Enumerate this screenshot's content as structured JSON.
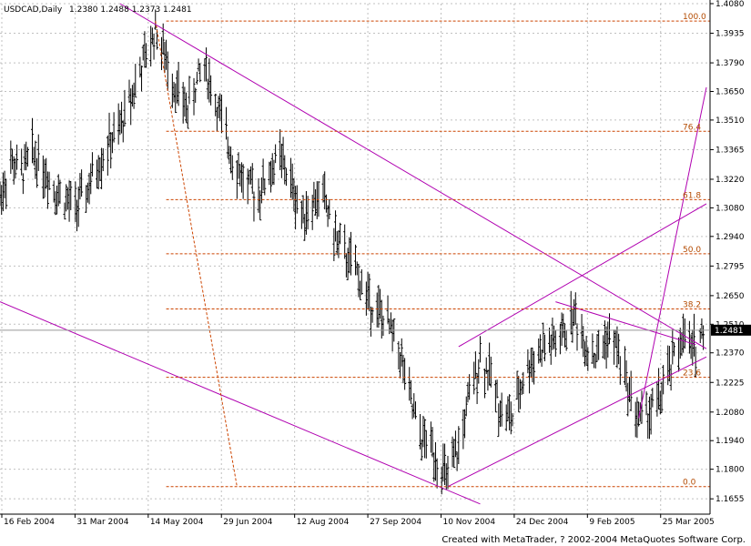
{
  "header": {
    "symbol": "USDCAD,Daily",
    "ohlc": "1.2380 1.2488 1.2373 1.2481"
  },
  "footer": "Created with MetaTrader, ? 2002-2004 MetaQuotes Software Corp.",
  "price_badge": "1.2481",
  "colors": {
    "grid": "#c0c0c0",
    "bars": "#000000",
    "trendline": "#b000b0",
    "fibonacci": "#cc4400"
  },
  "chart_data": {
    "type": "ohlc",
    "title": "USDCAD,Daily",
    "ylim": [
      1.158,
      1.408
    ],
    "y_ticks": [
      1.408,
      1.3935,
      1.379,
      1.365,
      1.351,
      1.3365,
      1.322,
      1.308,
      1.294,
      1.2795,
      1.265,
      1.251,
      1.237,
      1.2225,
      1.208,
      1.194,
      1.18,
      1.1655
    ],
    "x_ticks": [
      "16 Feb 2004",
      "31 Mar 2004",
      "14 May 2004",
      "29 Jun 2004",
      "12 Aug 2004",
      "27 Sep 2004",
      "10 Nov 2004",
      "24 Dec 2004",
      "9 Feb 2005",
      "25 Mar 2005"
    ],
    "x_range": [
      "2004-02-02",
      "2005-05-06"
    ],
    "fibonacci_levels": [
      {
        "label": "100.0",
        "price": 1.3995
      },
      {
        "label": "76.4",
        "price": 1.3455
      },
      {
        "label": "61.8",
        "price": 1.312
      },
      {
        "label": "50.0",
        "price": 1.2855
      },
      {
        "label": "38.2",
        "price": 1.2585
      },
      {
        "label": "23.6",
        "price": 1.225
      },
      {
        "label": "0.0",
        "price": 1.1715
      }
    ],
    "price_path": [
      [
        "2004-02-02",
        1.313
      ],
      [
        "2004-02-09",
        1.33
      ],
      [
        "2004-02-16",
        1.325
      ],
      [
        "2004-02-23",
        1.335
      ],
      [
        "2004-03-01",
        1.328
      ],
      [
        "2004-03-08",
        1.318
      ],
      [
        "2004-03-15",
        1.312
      ],
      [
        "2004-03-22",
        1.308
      ],
      [
        "2004-03-29",
        1.315
      ],
      [
        "2004-04-05",
        1.328
      ],
      [
        "2004-04-12",
        1.338
      ],
      [
        "2004-04-19",
        1.345
      ],
      [
        "2004-04-26",
        1.36
      ],
      [
        "2004-05-03",
        1.375
      ],
      [
        "2004-05-10",
        1.388
      ],
      [
        "2004-05-13",
        1.396
      ],
      [
        "2004-05-20",
        1.38
      ],
      [
        "2004-05-27",
        1.365
      ],
      [
        "2004-06-03",
        1.356
      ],
      [
        "2004-06-10",
        1.372
      ],
      [
        "2004-06-14",
        1.378
      ],
      [
        "2004-06-21",
        1.36
      ],
      [
        "2004-06-28",
        1.342
      ],
      [
        "2004-07-05",
        1.328
      ],
      [
        "2004-07-12",
        1.318
      ],
      [
        "2004-07-19",
        1.315
      ],
      [
        "2004-07-26",
        1.325
      ],
      [
        "2004-08-02",
        1.333
      ],
      [
        "2004-08-09",
        1.32
      ],
      [
        "2004-08-16",
        1.305
      ],
      [
        "2004-08-23",
        1.31
      ],
      [
        "2004-08-30",
        1.315
      ],
      [
        "2004-09-06",
        1.295
      ],
      [
        "2004-09-13",
        1.285
      ],
      [
        "2004-09-20",
        1.278
      ],
      [
        "2004-09-27",
        1.265
      ],
      [
        "2004-10-04",
        1.258
      ],
      [
        "2004-10-11",
        1.25
      ],
      [
        "2004-10-18",
        1.24
      ],
      [
        "2004-10-25",
        1.215
      ],
      [
        "2004-11-01",
        1.195
      ],
      [
        "2004-11-08",
        1.192
      ],
      [
        "2004-11-15",
        1.18
      ],
      [
        "2004-11-19",
        1.175
      ],
      [
        "2004-11-26",
        1.19
      ],
      [
        "2004-12-03",
        1.215
      ],
      [
        "2004-12-10",
        1.235
      ],
      [
        "2004-12-17",
        1.225
      ],
      [
        "2004-12-24",
        1.208
      ],
      [
        "2004-12-31",
        1.205
      ],
      [
        "2005-01-07",
        1.225
      ],
      [
        "2005-01-14",
        1.235
      ],
      [
        "2005-01-21",
        1.24
      ],
      [
        "2005-01-28",
        1.242
      ],
      [
        "2005-02-04",
        1.248
      ],
      [
        "2005-02-09",
        1.256
      ],
      [
        "2005-02-16",
        1.242
      ],
      [
        "2005-02-23",
        1.235
      ],
      [
        "2005-03-02",
        1.245
      ],
      [
        "2005-03-09",
        1.24
      ],
      [
        "2005-03-16",
        1.22
      ],
      [
        "2005-03-23",
        1.205
      ],
      [
        "2005-03-30",
        1.208
      ],
      [
        "2005-04-06",
        1.215
      ],
      [
        "2005-04-13",
        1.23
      ],
      [
        "2005-04-20",
        1.245
      ],
      [
        "2005-04-27",
        1.238
      ],
      [
        "2005-05-04",
        1.2481
      ]
    ]
  }
}
